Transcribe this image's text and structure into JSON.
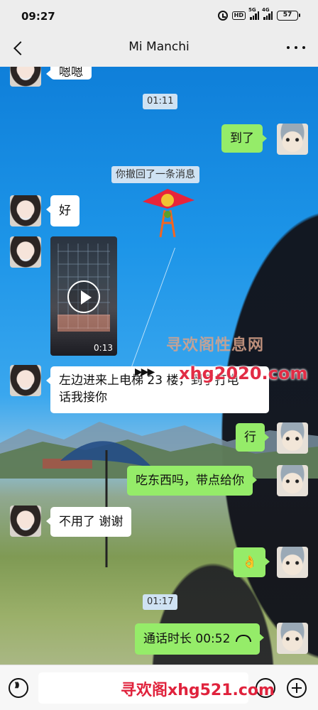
{
  "status_bar": {
    "time": "09:27",
    "battery": "57",
    "network_1": "5G",
    "network_2": "4G",
    "hd_label": "HD"
  },
  "header": {
    "title": "Mi Manchi"
  },
  "messages": {
    "partial_top": "嗯嗯",
    "time_1": "01:11",
    "arrived": "到了",
    "recalled_notice": "你撤回了一条消息",
    "good": "好",
    "video_duration": "0:13",
    "directions_line1": "左边进来上电梯 23 楼，到了打电",
    "directions_line2": "话我接你",
    "ok": "行",
    "eat_question": "吃东西吗，带点给你",
    "no_thanks": "不用了 谢谢",
    "ok_hand": "👌",
    "time_2": "01:17",
    "call_duration": "通话时长 00:52"
  },
  "watermarks": {
    "site_name": "寻欢阁性息网",
    "site_url": "xhg2020.com",
    "bottom_banner": "寻欢阁xhg521.com"
  },
  "icons": [
    "back-icon",
    "more-icon",
    "play-icon",
    "hangup-icon",
    "voice-icon",
    "emoji-icon",
    "plus-icon"
  ]
}
